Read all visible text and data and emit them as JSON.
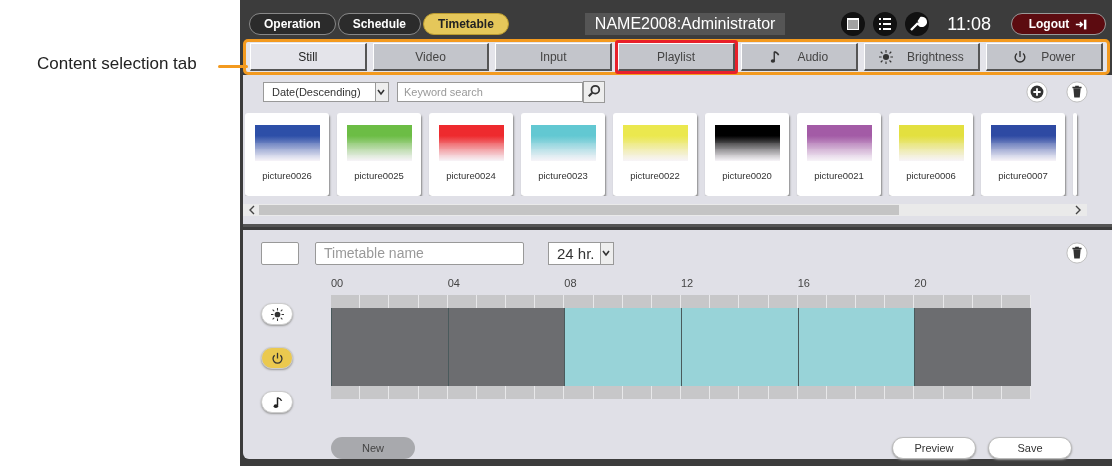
{
  "callout": {
    "label": "Content selection tab"
  },
  "top_bar": {
    "modes": [
      {
        "label": "Operation",
        "selected": false
      },
      {
        "label": "Schedule",
        "selected": false
      },
      {
        "label": "Timetable",
        "selected": true
      }
    ],
    "user": "NAME2008:Administrator",
    "time": "11:08",
    "logout": "Logout"
  },
  "tabs": [
    {
      "label": "Still",
      "kind": "plain",
      "selected": true,
      "highlighted": false
    },
    {
      "label": "Video",
      "kind": "plain",
      "selected": false,
      "highlighted": false
    },
    {
      "label": "Input",
      "kind": "plain",
      "selected": false,
      "highlighted": false
    },
    {
      "label": "Playlist",
      "kind": "plain",
      "selected": false,
      "highlighted": true
    },
    {
      "label": "Audio",
      "kind": "audio",
      "selected": false,
      "highlighted": false
    },
    {
      "label": "Brightness",
      "kind": "brightness",
      "selected": false,
      "highlighted": false
    },
    {
      "label": "Power",
      "kind": "power",
      "selected": false,
      "highlighted": false
    }
  ],
  "filter": {
    "sort": "Date(Descending)",
    "placeholder": "Keyword search"
  },
  "thumbnails": [
    {
      "name": "picture0026",
      "color": "#2d4fa8"
    },
    {
      "name": "picture0025",
      "color": "#6cbd45"
    },
    {
      "name": "picture0024",
      "color": "#ee2a2e"
    },
    {
      "name": "picture0023",
      "color": "#62c8d2"
    },
    {
      "name": "picture0022",
      "color": "#ebe84e"
    },
    {
      "name": "picture0020",
      "color": "#000000"
    },
    {
      "name": "picture0021",
      "color": "#a35ba6"
    },
    {
      "name": "picture0006",
      "color": "#e3e03f"
    },
    {
      "name": "picture0007",
      "color": "#2e4aa3"
    }
  ],
  "timetable": {
    "name_placeholder": "Timetable name",
    "period": "24 hr.",
    "hour_labels": [
      "00",
      "04",
      "08",
      "12",
      "16",
      "20"
    ],
    "modes": [
      {
        "kind": "brightness",
        "selected": false
      },
      {
        "kind": "power",
        "selected": true
      },
      {
        "kind": "audio",
        "selected": false
      }
    ],
    "slots": [
      {
        "active": false
      },
      {
        "active": false
      },
      {
        "active": false
      },
      {
        "active": false
      },
      {
        "active": false
      },
      {
        "active": false
      },
      {
        "active": false
      },
      {
        "active": false
      },
      {
        "active": true
      },
      {
        "active": true
      },
      {
        "active": true
      },
      {
        "active": true
      },
      {
        "active": true
      },
      {
        "active": true
      },
      {
        "active": true
      },
      {
        "active": true
      },
      {
        "active": true
      },
      {
        "active": true
      },
      {
        "active": true
      },
      {
        "active": true
      },
      {
        "active": false
      },
      {
        "active": false
      },
      {
        "active": false
      },
      {
        "active": false
      }
    ],
    "buttons": {
      "new": "New",
      "preview": "Preview",
      "save": "Save"
    }
  }
}
